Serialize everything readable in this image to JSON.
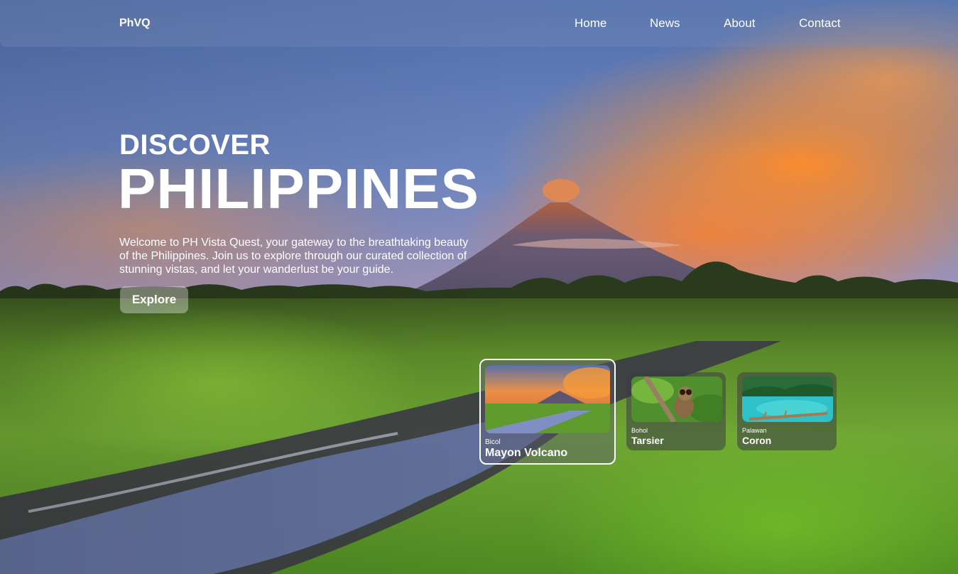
{
  "nav": {
    "brand": "PhVQ",
    "links": [
      {
        "label": "Home"
      },
      {
        "label": "News"
      },
      {
        "label": "About"
      },
      {
        "label": "Contact"
      }
    ]
  },
  "hero": {
    "subtitle": "DISCOVER",
    "title": "PHILIPPINES",
    "description": "Welcome to PH Vista Quest, your gateway to the breathtaking beauty of the Philippines. Join us to explore through our curated collection of stunning vistas, and let your wanderlust be your guide.",
    "cta_label": "Explore"
  },
  "destinations": [
    {
      "region": "Bicol",
      "name": "Mayon Volcano",
      "active": true
    },
    {
      "region": "Bohol",
      "name": "Tarsier",
      "active": false
    },
    {
      "region": "Palawan",
      "name": "Coron",
      "active": false
    }
  ]
}
